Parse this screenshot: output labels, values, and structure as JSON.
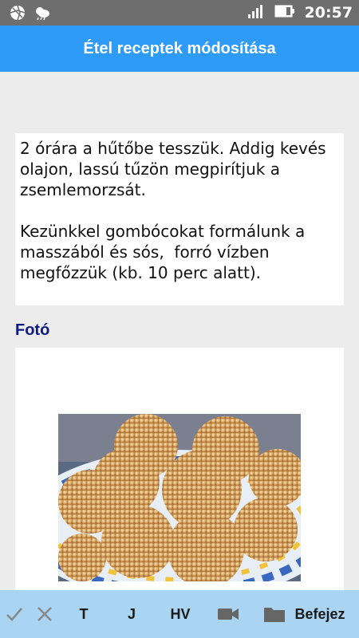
{
  "status_bar": {
    "time": "20:57",
    "icons": [
      "aperture-icon",
      "weather-icon",
      "signal-icon",
      "battery-icon"
    ]
  },
  "app_bar": {
    "title": "Étel receptek módosítása"
  },
  "recipe": {
    "text": "2 órára a hűtőbe tesszük. Addig kevés olajon, lassú tűzön megpirítjuk a zsemlemorzsát.\n\nKezünkkel gombócokat formálunk a masszából és sós,  forró vízben megfőzzük (kb. 10 perc alatt)."
  },
  "photo_section": {
    "label": "Fotó"
  },
  "bottom_bar": {
    "check_icon": "check-icon",
    "close_icon": "close-icon",
    "t_label": "T",
    "j_label": "J",
    "hv_label": "HV",
    "video_icon": "video-camera-icon",
    "folder_icon": "folder-icon",
    "finish_label": "Befejez"
  },
  "colors": {
    "app_bar": "#2f9bf8",
    "status_bar": "#6e6e6e",
    "bottom_bar": "#a9d4f2",
    "section_label": "#0b1b7e"
  }
}
